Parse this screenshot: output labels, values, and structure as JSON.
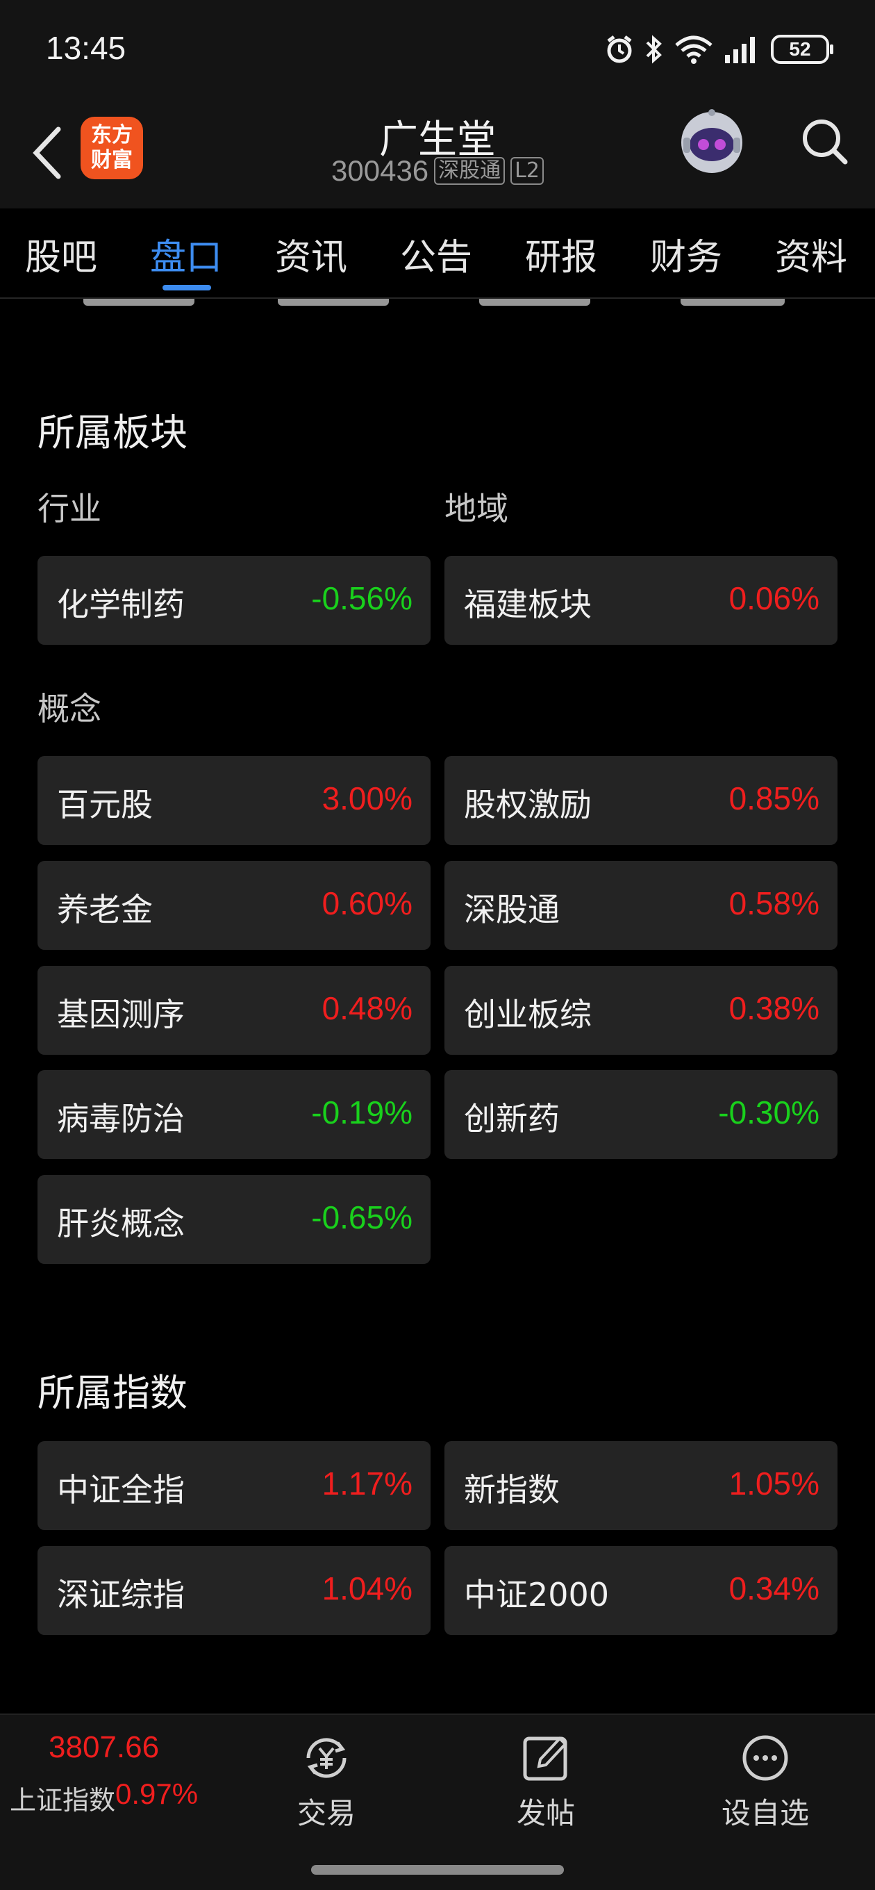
{
  "status_bar": {
    "time": "13:45",
    "battery": "52"
  },
  "header": {
    "app_logo_line1": "东方",
    "app_logo_line2": "财富",
    "stock_name": "广生堂",
    "stock_code": "300436",
    "tag_connect": "深股通",
    "tag_level": "L2"
  },
  "tabs": [
    {
      "label": "股吧",
      "active": false
    },
    {
      "label": "盘口",
      "active": true
    },
    {
      "label": "资讯",
      "active": false
    },
    {
      "label": "公告",
      "active": false
    },
    {
      "label": "研报",
      "active": false
    },
    {
      "label": "财务",
      "active": false
    },
    {
      "label": "资料",
      "active": false
    }
  ],
  "sectors": {
    "title": "所属板块",
    "industry_label": "行业",
    "region_label": "地域",
    "concept_label": "概念",
    "industry": {
      "name": "化学制药",
      "change": "-0.56%"
    },
    "region": {
      "name": "福建板块",
      "change": "0.06%"
    },
    "concepts": [
      {
        "name": "百元股",
        "change": "3.00%"
      },
      {
        "name": "股权激励",
        "change": "0.85%"
      },
      {
        "name": "养老金",
        "change": "0.60%"
      },
      {
        "name": "深股通",
        "change": "0.58%"
      },
      {
        "name": "基因测序",
        "change": "0.48%"
      },
      {
        "name": "创业板综",
        "change": "0.38%"
      },
      {
        "name": "病毒防治",
        "change": "-0.19%"
      },
      {
        "name": "创新药",
        "change": "-0.30%"
      },
      {
        "name": "肝炎概念",
        "change": "-0.65%"
      }
    ]
  },
  "indices": {
    "title": "所属指数",
    "items": [
      {
        "name": "中证全指",
        "change": "1.17%"
      },
      {
        "name": "新指数",
        "change": "1.05%"
      },
      {
        "name": "深证综指",
        "change": "1.04%"
      },
      {
        "name": "中证2000",
        "change": "0.34%"
      }
    ]
  },
  "bottom_bar": {
    "index_value": "3807.66",
    "index_name": "上证指数",
    "index_change": "0.97%",
    "trade_label": "交易",
    "post_label": "发帖",
    "watchlist_label": "设自选"
  },
  "colors": {
    "up": "#f01e1e",
    "down": "#19d11c",
    "accent": "#3d8cf0",
    "card_bg": "#242424"
  }
}
